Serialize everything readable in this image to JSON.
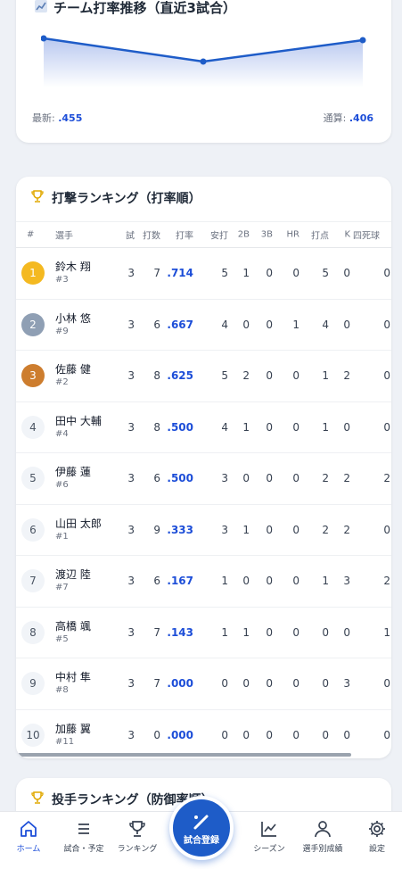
{
  "trend": {
    "icon": "chart-icon",
    "title": "チーム打率推移（直近3試合）",
    "latest_label": "最新:",
    "latest_value": ".455",
    "total_label": "通算:",
    "total_value": ".406"
  },
  "ranking": {
    "title": "打撃ランキング（打率順）",
    "headers": [
      "#",
      "選手",
      "試",
      "打数",
      "打率",
      "安打",
      "2B",
      "3B",
      "HR",
      "打点",
      "K",
      "四死球"
    ],
    "rows": [
      {
        "rank": "1",
        "name": "鈴木 翔",
        "number": "#3",
        "g": "3",
        "ab": "7",
        "avg": ".714",
        "h": "5",
        "d": "1",
        "t": "0",
        "hr": "0",
        "rbi": "5",
        "k": "0",
        "bb": "0"
      },
      {
        "rank": "2",
        "name": "小林 悠",
        "number": "#9",
        "g": "3",
        "ab": "6",
        "avg": ".667",
        "h": "4",
        "d": "0",
        "t": "0",
        "hr": "1",
        "rbi": "4",
        "k": "0",
        "bb": "0"
      },
      {
        "rank": "3",
        "name": "佐藤 健",
        "number": "#2",
        "g": "3",
        "ab": "8",
        "avg": ".625",
        "h": "5",
        "d": "2",
        "t": "0",
        "hr": "0",
        "rbi": "1",
        "k": "2",
        "bb": "0"
      },
      {
        "rank": "4",
        "name": "田中 大輔",
        "number": "#4",
        "g": "3",
        "ab": "8",
        "avg": ".500",
        "h": "4",
        "d": "1",
        "t": "0",
        "hr": "0",
        "rbi": "1",
        "k": "0",
        "bb": "0"
      },
      {
        "rank": "5",
        "name": "伊藤 蓮",
        "number": "#6",
        "g": "3",
        "ab": "6",
        "avg": ".500",
        "h": "3",
        "d": "0",
        "t": "0",
        "hr": "0",
        "rbi": "2",
        "k": "2",
        "bb": "2"
      },
      {
        "rank": "6",
        "name": "山田 太郎",
        "number": "#1",
        "g": "3",
        "ab": "9",
        "avg": ".333",
        "h": "3",
        "d": "1",
        "t": "0",
        "hr": "0",
        "rbi": "2",
        "k": "2",
        "bb": "0"
      },
      {
        "rank": "7",
        "name": "渡辺 陸",
        "number": "#7",
        "g": "3",
        "ab": "6",
        "avg": ".167",
        "h": "1",
        "d": "0",
        "t": "0",
        "hr": "0",
        "rbi": "1",
        "k": "3",
        "bb": "2"
      },
      {
        "rank": "8",
        "name": "高橋 颯",
        "number": "#5",
        "g": "3",
        "ab": "7",
        "avg": ".143",
        "h": "1",
        "d": "1",
        "t": "0",
        "hr": "0",
        "rbi": "0",
        "k": "0",
        "bb": "1"
      },
      {
        "rank": "9",
        "name": "中村 隼",
        "number": "#8",
        "g": "3",
        "ab": "7",
        "avg": ".000",
        "h": "0",
        "d": "0",
        "t": "0",
        "hr": "0",
        "rbi": "0",
        "k": "3",
        "bb": "0"
      },
      {
        "rank": "10",
        "name": "加藤 翼",
        "number": "#11",
        "g": "3",
        "ab": "0",
        "avg": ".000",
        "h": "0",
        "d": "0",
        "t": "0",
        "hr": "0",
        "rbi": "0",
        "k": "0",
        "bb": "0"
      }
    ]
  },
  "pitching": {
    "title": "投手ランキング（防御率順）"
  },
  "nav": {
    "home": "ホーム",
    "schedule": "試合・予定",
    "ranking": "ランキング",
    "register": "試合登録",
    "season": "シーズン",
    "players": "選手別成績",
    "settings": "設定"
  },
  "colors": {
    "accent": "#1e5cc8",
    "gold": "#f4b921",
    "silver": "#8f9fb4",
    "bronze": "#cd7d2e"
  }
}
